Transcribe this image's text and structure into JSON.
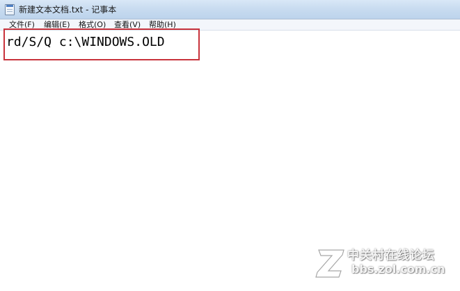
{
  "window": {
    "title": "新建文本文档.txt - 记事本"
  },
  "menu": {
    "items": [
      {
        "label": "文件(F)"
      },
      {
        "label": "编辑(E)"
      },
      {
        "label": "格式(O)"
      },
      {
        "label": "查看(V)"
      },
      {
        "label": "帮助(H)"
      }
    ]
  },
  "editor": {
    "content": "rd/S/Q c:\\WINDOWS.OLD"
  },
  "annotation": {
    "highlight_color": "#c8323b"
  },
  "watermark": {
    "site_name": "中关村在线论坛",
    "url": "bbs.zol.com.cn",
    "logo_icon": "zol-logo-icon"
  },
  "colors": {
    "titlebar": "#c9dcf0",
    "menubar": "#f3f6fb",
    "editor_bg": "#ffffff",
    "text": "#000000"
  }
}
